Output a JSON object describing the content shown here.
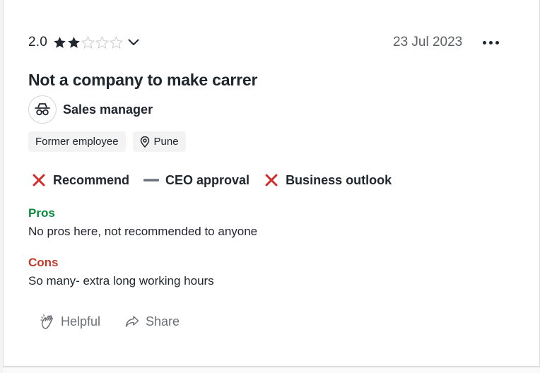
{
  "review": {
    "rating": "2.0",
    "stars_filled": 2,
    "stars_total": 5,
    "date": "23 Jul 2023",
    "title": "Not a company to make carrer",
    "job_title": "Sales manager",
    "tags": {
      "employment": "Former employee",
      "location": "Pune"
    },
    "verdicts": [
      {
        "label": "Recommend",
        "status": "negative",
        "icon": "x-icon"
      },
      {
        "label": "CEO approval",
        "status": "neutral",
        "icon": "dash-icon"
      },
      {
        "label": "Business outlook",
        "status": "negative",
        "icon": "x-icon"
      }
    ],
    "pros": {
      "label": "Pros",
      "text": "No pros here, not recommended to anyone"
    },
    "cons": {
      "label": "Cons",
      "text": "So many- extra long working hours"
    },
    "actions": {
      "helpful": "Helpful",
      "share": "Share"
    }
  },
  "colors": {
    "star": "#20262e",
    "star_empty": "#c9c9c9",
    "negative": "#d12d2d",
    "neutral": "#6b7280",
    "pros": "#0a8a3c",
    "cons": "#c0392b"
  }
}
